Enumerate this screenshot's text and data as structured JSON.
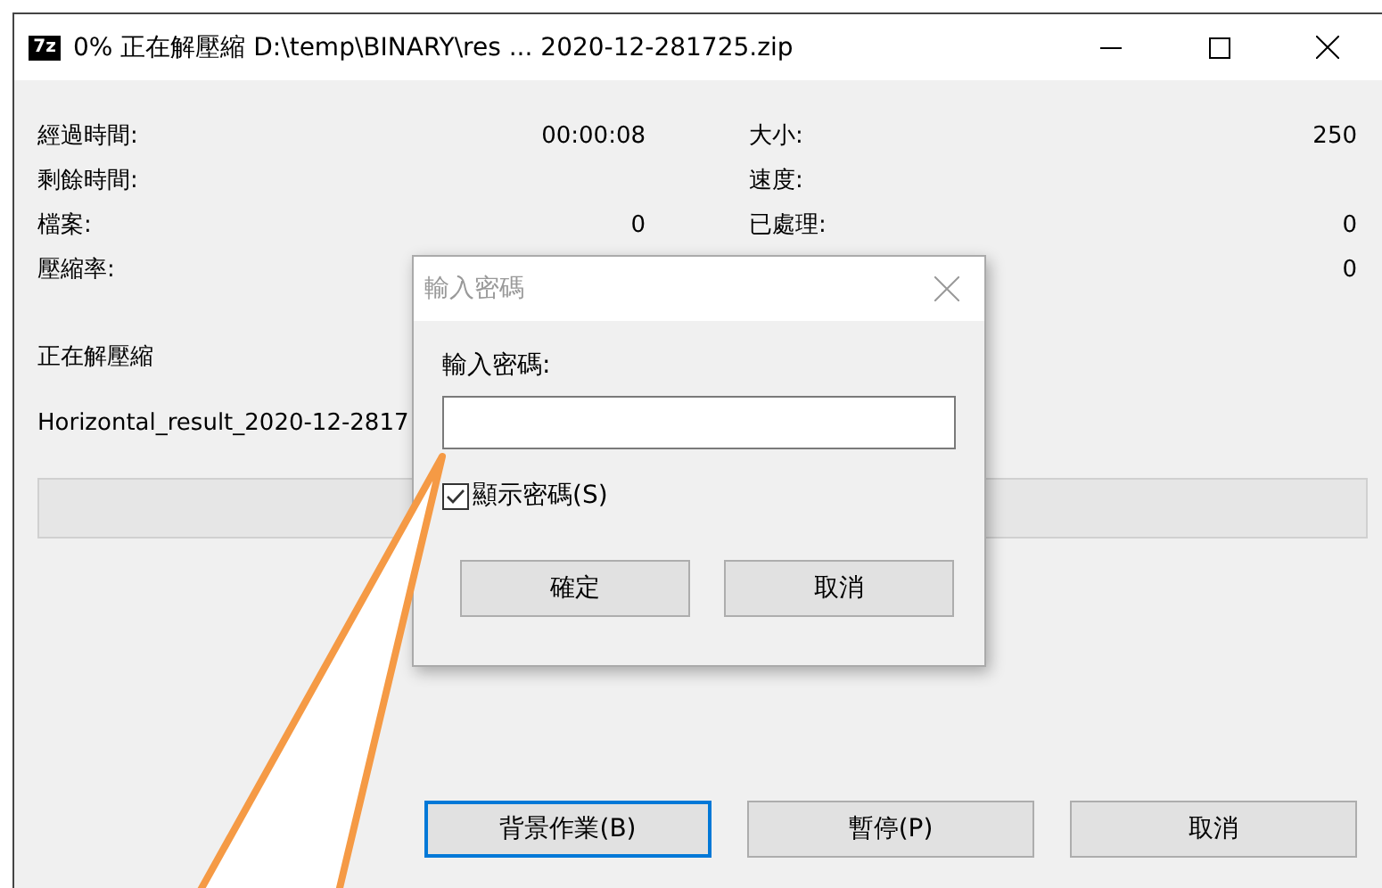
{
  "window": {
    "icon_text": "7z",
    "title": "0% 正在解壓縮 D:\\temp\\BINARY\\res ... 2020-12-281725.zip"
  },
  "stats": [
    {
      "label": "經過時間:",
      "value": "00:00:08",
      "label_2": "大小:",
      "value_2": "250"
    },
    {
      "label": "剩餘時間:",
      "label_2": "速度:"
    },
    {
      "label": "檔案:",
      "value": "0",
      "label_2": "已處理:",
      "value_2": "0"
    },
    {
      "label": "壓縮率:",
      "value_2": "0"
    }
  ],
  "status": "正在解壓縮",
  "current_file": "Horizontal_result_2020-12-2817",
  "progress": {
    "level": 0
  },
  "buttons": [
    {
      "label": "背景作業(B)",
      "focused": true
    },
    {
      "label": "暫停(P)",
      "focused": false
    },
    {
      "label": "取消",
      "focused": false
    }
  ],
  "dialog": {
    "title": "輸入密碼",
    "field_label": "輸入密碼:",
    "show_password": {
      "label": "顯示密碼(S)",
      "checked": true
    },
    "buttons": [
      "確定",
      "取消"
    ]
  }
}
